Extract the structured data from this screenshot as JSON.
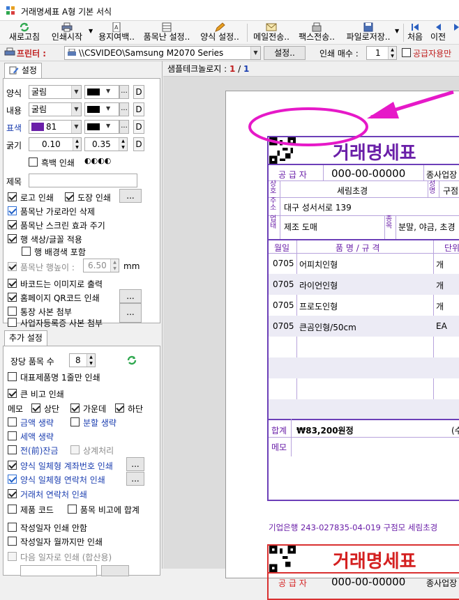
{
  "window": {
    "title": "거래명세표    A형 기본 서식",
    "app_icon": "grid-app-icon"
  },
  "toolbar": {
    "items": [
      {
        "label": "새로고침",
        "icon": "refresh-icon"
      },
      {
        "label": "인쇄시작",
        "icon": "printer-icon"
      },
      {
        "label": "용지여백..",
        "icon": "page-margin-icon"
      },
      {
        "label": "품목난 설정..",
        "icon": "table-settings-icon"
      },
      {
        "label": "양식 설정..",
        "icon": "pencil-icon"
      },
      {
        "label": "메일전송..",
        "icon": "mail-icon"
      },
      {
        "label": "팩스전송..",
        "icon": "fax-icon"
      },
      {
        "label": "파일로저장..",
        "icon": "save-file-icon"
      },
      {
        "label": "처음",
        "icon": "first-page-icon"
      },
      {
        "label": "이전",
        "icon": "prev-page-icon"
      }
    ]
  },
  "printer_bar": {
    "label": "프린터 :",
    "printer": "\\\\CSVIDEO\\Samsung M2070 Series",
    "settings_button": "설정..",
    "copies_label": "인쇄 매수 :",
    "copies": "1",
    "supplier_only": "공급자용만"
  },
  "settings_tab": {
    "tab_label": "설정",
    "style_label": "양식",
    "style_font": "굴림",
    "content_label": "내용",
    "content_font": "굴림",
    "color_label": "표색",
    "color_value": "81",
    "thickness_label": "굵기",
    "thickness_1": "0.10",
    "thickness_2": "0.35",
    "d_button": "D",
    "bw_print": "흑백 인쇄",
    "bw_symbols": "◐◐◐◐",
    "title_label": "제목",
    "title_value": "",
    "logo_print": "로고 인쇄",
    "stamp_print": "도장 인쇄",
    "dots_button": "...",
    "remove_hlines": "품목난 가로라인 삭제",
    "screen_effect": "품목난 스크린 효과 주기",
    "row_color_font": "행 색상/글꼴 적용",
    "include_row_bg": "행 배경색 포함",
    "row_height_label": "품목난 행높이 :",
    "row_height": "6.50",
    "row_height_unit": "mm",
    "barcode_image": "바코드는 이미지로 출력",
    "homepage_qr": "홈페이지 QR코드 인쇄",
    "bankbook_copy": "통장 사본 첨부",
    "business_reg_copy": "사업자등록증 사본 첨부"
  },
  "extra_tab": {
    "tab_label": "추가 설정",
    "items_per_page_label": "장당 품목 수",
    "items_per_page": "8",
    "rep_item_one_line": "대표제품명 1줄만 인쇄",
    "big_remarks": "큰 비고 인쇄",
    "memo_label": "메모",
    "memo_top": "상단",
    "memo_middle": "가운데",
    "memo_bottom": "하단",
    "omit_amount": "금액 생략",
    "split_omit": "분할 생략",
    "omit_tax": "세액 생략",
    "prev_balance": "전(前)잔금",
    "offset_process": "상계처리",
    "style_account": "양식 일체형 계좌번호 인쇄",
    "style_contact": "양식 일체형 연락처 인쇄",
    "client_contact": "거래처 연락처 인쇄",
    "product_code": "제품 코드",
    "item_remarks_total": "품목 비고에 합계",
    "no_write_date": "작성일자 인쇄 안함",
    "write_date_month": "작성일자 월까지만 인쇄",
    "next_date_print": "다음 일자로 인쇄 (합산용)"
  },
  "preview": {
    "header_label": "샘플테크놀로지 :",
    "page_current": "1",
    "page_sep": "/",
    "page_total": "1",
    "highlight_color": "#e619c8",
    "invoice": {
      "title": "거래명세표",
      "supplier_label": "공 급 자",
      "biz_no": "000-00-00000",
      "biz_place_label": "종사업장",
      "name_label": "상호",
      "company": "세림초경",
      "owner_label": "성명",
      "owner": "구점",
      "address_label": "주소",
      "address": "대구 성서서로 139",
      "biz_type_label": "업태",
      "biz_type": "제조 도매",
      "biz_item_label": "종목",
      "biz_item": "분말, 야금, 초경",
      "columns": [
        "월일",
        "품 명 / 규 격",
        "단위"
      ],
      "rows": [
        {
          "date": "0705",
          "name": "어피치인형",
          "unit": "개"
        },
        {
          "date": "0705",
          "name": "라이언인형",
          "unit": "개"
        },
        {
          "date": "0705",
          "name": "프로도인형",
          "unit": "개"
        },
        {
          "date": "0705",
          "name": "큰곰인형/50cm",
          "unit": "EA"
        }
      ],
      "total_label": "합계",
      "total": "₩83,200원정",
      "total_extra": "(수",
      "memo_label": "메모",
      "bank_line": "기업은행 243-027835-04-019 구점모 세림초경"
    },
    "invoice2": {
      "title": "거래명세표",
      "supplier_label": "공 급 자",
      "biz_no": "000-00-00000",
      "biz_place_label": "종사업장"
    }
  }
}
